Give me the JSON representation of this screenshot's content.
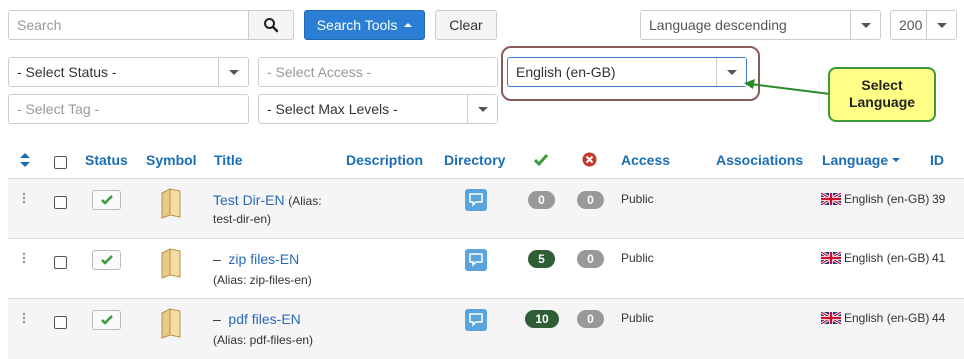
{
  "toolbar": {
    "search_placeholder": "Search",
    "search_tools_label": "Search Tools",
    "clear_label": "Clear",
    "ordering_value": "Language descending",
    "limit_value": "200"
  },
  "filters": {
    "status_value": "- Select Status -",
    "access_value": "- Select Access -",
    "language_value": "English (en-GB)",
    "tag_value": "- Select Tag -",
    "max_levels_value": "- Select Max Levels -"
  },
  "callout": {
    "line1": "Select",
    "line2": "Language"
  },
  "table": {
    "headers": {
      "status": "Status",
      "symbol": "Symbol",
      "title": "Title",
      "description": "Description",
      "directory": "Directory",
      "access": "Access",
      "associations": "Associations",
      "language": "Language",
      "id": "ID"
    },
    "rows": [
      {
        "title": "Test Dir-EN",
        "alias_prefix": "(Alias:",
        "alias": "test-dir-en)",
        "published_count": "0",
        "unpublished_count": "0",
        "access": "Public",
        "language": "English (en-GB)",
        "id": "39"
      },
      {
        "dash": "–",
        "title": "zip files-EN",
        "alias": "(Alias: zip-files-en)",
        "published_count": "5",
        "unpublished_count": "0",
        "access": "Public",
        "language": "English (en-GB)",
        "id": "41"
      },
      {
        "dash": "–",
        "title": "pdf files-EN",
        "alias": "(Alias: pdf-files-en)",
        "published_count": "10",
        "unpublished_count": "0",
        "access": "Public",
        "language": "English (en-GB)",
        "id": "44"
      }
    ]
  },
  "colors": {
    "primary": "#2a7fd4",
    "link": "#1a6eb5",
    "published_green": "#2e5d36",
    "unpublished_red": "#c0392b",
    "callout_bg": "#ffff88",
    "callout_border": "#3c9a3c"
  }
}
